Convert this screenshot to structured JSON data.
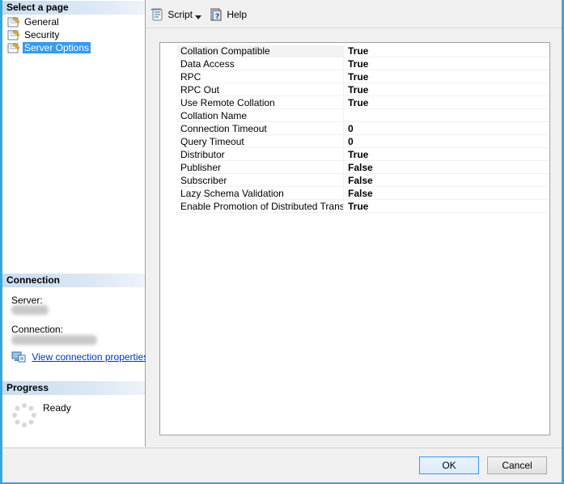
{
  "left_panel": {
    "select_page_title": "Select a page",
    "pages": [
      {
        "label": "General",
        "selected": false
      },
      {
        "label": "Security",
        "selected": false
      },
      {
        "label": "Server Options",
        "selected": true
      }
    ],
    "connection_title": "Connection",
    "server_label": "Server:",
    "connection_label": "Connection:",
    "view_connection_link": "View connection properties",
    "progress_title": "Progress",
    "progress_status": "Ready"
  },
  "toolbar": {
    "script_label": "Script",
    "help_label": "Help"
  },
  "properties": [
    {
      "name": "Collation Compatible",
      "value": "True"
    },
    {
      "name": "Data Access",
      "value": "True"
    },
    {
      "name": "RPC",
      "value": "True"
    },
    {
      "name": "RPC Out",
      "value": "True"
    },
    {
      "name": "Use Remote Collation",
      "value": "True"
    },
    {
      "name": "Collation Name",
      "value": ""
    },
    {
      "name": "Connection Timeout",
      "value": "0"
    },
    {
      "name": "Query Timeout",
      "value": "0"
    },
    {
      "name": "Distributor",
      "value": "True"
    },
    {
      "name": "Publisher",
      "value": "False"
    },
    {
      "name": "Subscriber",
      "value": "False"
    },
    {
      "name": "Lazy Schema Validation",
      "value": "False"
    },
    {
      "name": "Enable Promotion of Distributed Transaction",
      "value": "True"
    }
  ],
  "footer": {
    "ok_label": "OK",
    "cancel_label": "Cancel"
  }
}
